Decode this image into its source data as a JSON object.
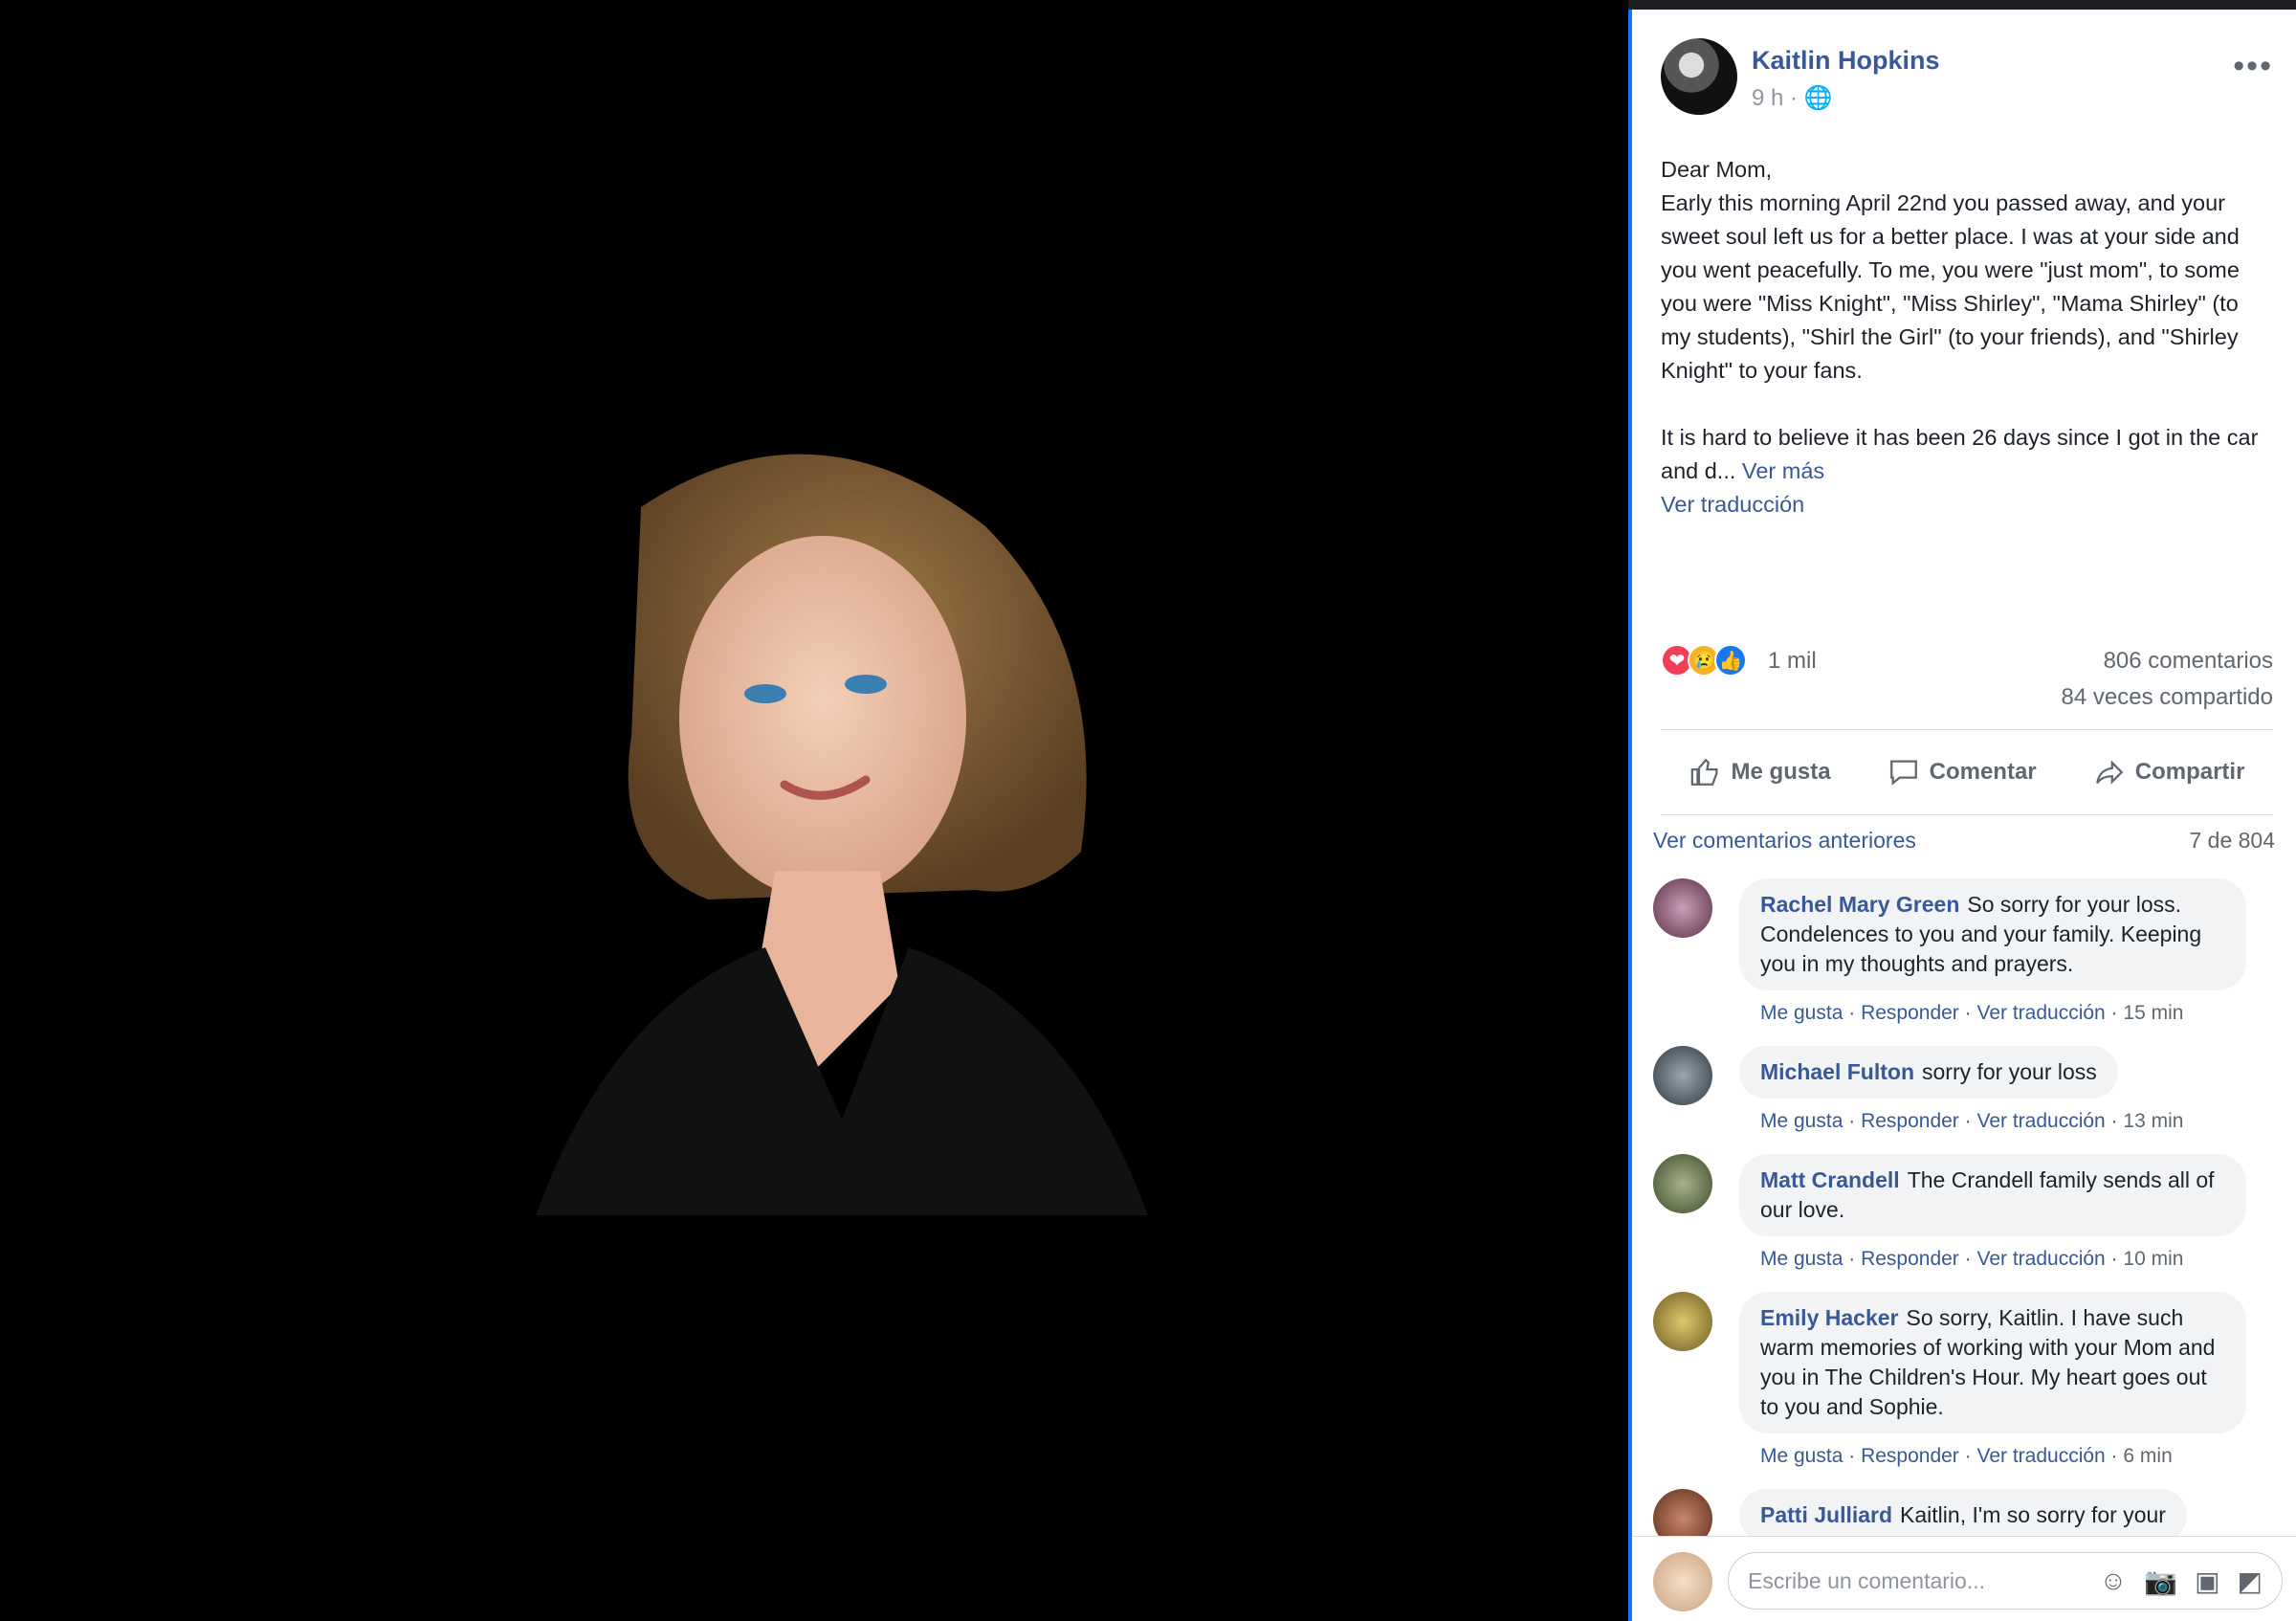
{
  "post": {
    "author": "Kaitlin Hopkins",
    "time": "9 h · ",
    "text": "Dear Mom,\nEarly this morning April 22nd you passed away, and your sweet soul left us for a better place. I was at your side and you went peacefully. To me, you were \"just mom\", to some you were \"Miss Knight\", \"Miss Shirley\", \"Mama Shirley\" (to my students), \"Shirl the Girl\" (to your friends), and \"Shirley Knight\" to your fans.\n\nIt is hard to believe it has been 26 days since I got in the car and d...",
    "see_more": " Ver más",
    "translate": "Ver traducción"
  },
  "stats": {
    "reactions": "1 mil",
    "comments": "806 comentarios",
    "shares": "84 veces compartido"
  },
  "actions": {
    "like": "Me gusta",
    "comment": "Comentar",
    "share": "Compartir"
  },
  "comments_header": {
    "previous": "Ver comentarios anteriores",
    "count": "7 de 804"
  },
  "comments": [
    {
      "name": "Rachel Mary Green",
      "text": "So sorry for your loss. Condelences to you and your family. Keeping you in my thoughts and prayers.",
      "like": "Me gusta",
      "reply": "Responder",
      "translate": "Ver traducción",
      "time": "15 min"
    },
    {
      "name": "Michael Fulton",
      "text": "sorry for your loss",
      "like": "Me gusta",
      "reply": "Responder",
      "translate": "Ver traducción",
      "time": "13 min"
    },
    {
      "name": "Matt Crandell",
      "text": "The Crandell family sends all of our love.",
      "like": "Me gusta",
      "reply": "Responder",
      "translate": "Ver traducción",
      "time": "10 min"
    },
    {
      "name": "Emily Hacker",
      "text": "So sorry, Kaitlin. I have such warm memories of working with your Mom and you in The Children's Hour. My heart goes out to you and Sophie.",
      "like": "Me gusta",
      "reply": "Responder",
      "translate": "Ver traducción",
      "time": "6 min"
    },
    {
      "name": "Patti Julliard",
      "text": "Kaitlin, I'm so sorry for your"
    }
  ],
  "composer": {
    "placeholder": "Escribe un comentario..."
  },
  "colors": {
    "link": "#385898",
    "accent": "#1877f2"
  }
}
